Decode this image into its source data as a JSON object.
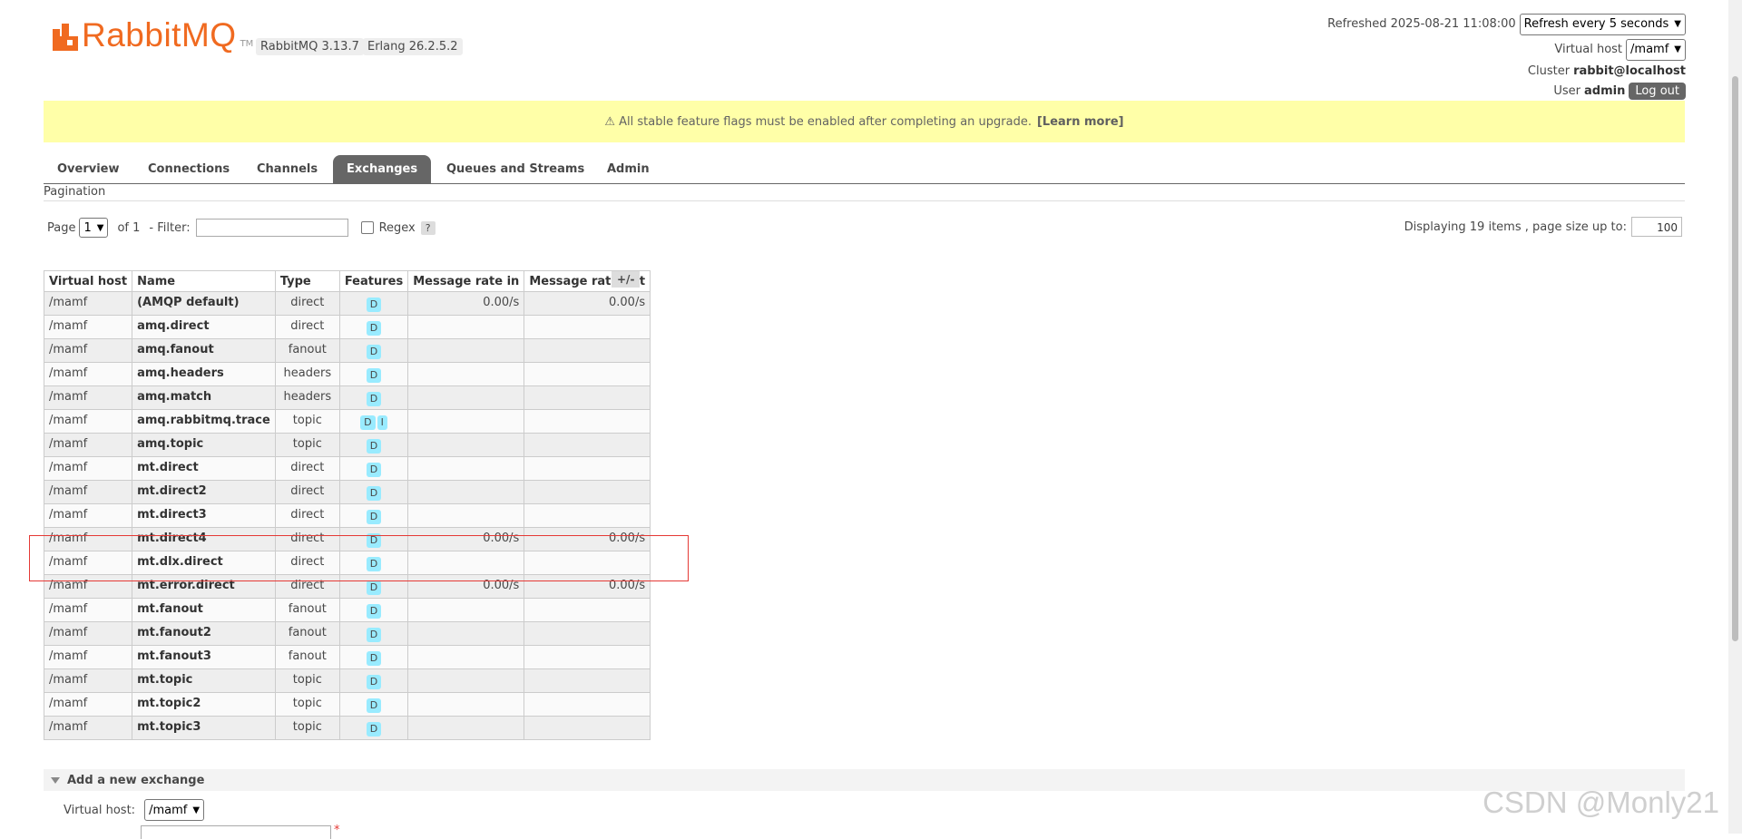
{
  "header": {
    "logo_text": "RabbitMQ",
    "logo_tm": "TM",
    "rabbitmq_version": "RabbitMQ 3.13.7",
    "erlang_version": "Erlang 26.2.5.2",
    "refreshed": "Refreshed 2025-08-21 11:08:00",
    "refresh_select": "Refresh every 5 seconds",
    "vhost_label": "Virtual host",
    "vhost_value": "/mamf",
    "cluster_label": "Cluster",
    "cluster_value": "rabbit@localhost",
    "user_label": "User",
    "user_value": "admin",
    "logout_label": "Log out"
  },
  "banner": {
    "text": "⚠ All stable feature flags must be enabled after completing an upgrade.",
    "link": "[Learn more]"
  },
  "tabs": [
    {
      "label": "Overview"
    },
    {
      "label": "Connections"
    },
    {
      "label": "Channels"
    },
    {
      "label": "Exchanges",
      "active": true
    },
    {
      "label": "Queues and Streams"
    },
    {
      "label": "Admin"
    }
  ],
  "pagination": {
    "section_label": "Pagination",
    "page_label": "Page",
    "page_value": "1",
    "of_label": "of 1",
    "filter_label": "- Filter:",
    "filter_value": "",
    "regex_label": "Regex",
    "help_label": "?",
    "display_text": "Displaying 19 items , page size up to:",
    "page_size": "100"
  },
  "table": {
    "columns": [
      "Virtual host",
      "Name",
      "Type",
      "Features",
      "Message rate in",
      "Message rate out"
    ],
    "plus_minus": "+/-",
    "rows": [
      {
        "vhost": "/mamf",
        "name": "(AMQP default)",
        "type": "direct",
        "f1": "D",
        "f2": "",
        "rate_in": "0.00/s",
        "rate_out": "0.00/s"
      },
      {
        "vhost": "/mamf",
        "name": "amq.direct",
        "type": "direct",
        "f1": "D",
        "f2": "",
        "rate_in": "",
        "rate_out": ""
      },
      {
        "vhost": "/mamf",
        "name": "amq.fanout",
        "type": "fanout",
        "f1": "D",
        "f2": "",
        "rate_in": "",
        "rate_out": ""
      },
      {
        "vhost": "/mamf",
        "name": "amq.headers",
        "type": "headers",
        "f1": "D",
        "f2": "",
        "rate_in": "",
        "rate_out": ""
      },
      {
        "vhost": "/mamf",
        "name": "amq.match",
        "type": "headers",
        "f1": "D",
        "f2": "",
        "rate_in": "",
        "rate_out": ""
      },
      {
        "vhost": "/mamf",
        "name": "amq.rabbitmq.trace",
        "type": "topic",
        "f1": "D",
        "f2": "I",
        "rate_in": "",
        "rate_out": ""
      },
      {
        "vhost": "/mamf",
        "name": "amq.topic",
        "type": "topic",
        "f1": "D",
        "f2": "",
        "rate_in": "",
        "rate_out": ""
      },
      {
        "vhost": "/mamf",
        "name": "mt.direct",
        "type": "direct",
        "f1": "D",
        "f2": "",
        "rate_in": "",
        "rate_out": ""
      },
      {
        "vhost": "/mamf",
        "name": "mt.direct2",
        "type": "direct",
        "f1": "D",
        "f2": "",
        "rate_in": "",
        "rate_out": ""
      },
      {
        "vhost": "/mamf",
        "name": "mt.direct3",
        "type": "direct",
        "f1": "D",
        "f2": "",
        "rate_in": "",
        "rate_out": ""
      },
      {
        "vhost": "/mamf",
        "name": "mt.direct4",
        "type": "direct",
        "f1": "D",
        "f2": "",
        "rate_in": "0.00/s",
        "rate_out": "0.00/s"
      },
      {
        "vhost": "/mamf",
        "name": "mt.dlx.direct",
        "type": "direct",
        "f1": "D",
        "f2": "",
        "rate_in": "",
        "rate_out": ""
      },
      {
        "vhost": "/mamf",
        "name": "mt.error.direct",
        "type": "direct",
        "f1": "D",
        "f2": "",
        "rate_in": "0.00/s",
        "rate_out": "0.00/s"
      },
      {
        "vhost": "/mamf",
        "name": "mt.fanout",
        "type": "fanout",
        "f1": "D",
        "f2": "",
        "rate_in": "",
        "rate_out": ""
      },
      {
        "vhost": "/mamf",
        "name": "mt.fanout2",
        "type": "fanout",
        "f1": "D",
        "f2": "",
        "rate_in": "",
        "rate_out": ""
      },
      {
        "vhost": "/mamf",
        "name": "mt.fanout3",
        "type": "fanout",
        "f1": "D",
        "f2": "",
        "rate_in": "",
        "rate_out": ""
      },
      {
        "vhost": "/mamf",
        "name": "mt.topic",
        "type": "topic",
        "f1": "D",
        "f2": "",
        "rate_in": "",
        "rate_out": ""
      },
      {
        "vhost": "/mamf",
        "name": "mt.topic2",
        "type": "topic",
        "f1": "D",
        "f2": "",
        "rate_in": "",
        "rate_out": ""
      },
      {
        "vhost": "/mamf",
        "name": "mt.topic3",
        "type": "topic",
        "f1": "D",
        "f2": "",
        "rate_in": "",
        "rate_out": ""
      }
    ]
  },
  "add_exchange": {
    "title": "Add a new exchange",
    "vhost_label": "Virtual host:",
    "vhost_value": "/mamf",
    "required_mark": "*"
  },
  "watermark": "CSDN @Monly21",
  "colors": {
    "brand_orange": "#f06a20",
    "banner_yellow": "#ffff99",
    "feature_badge": "#99ebff",
    "highlight_red": "#e53935"
  }
}
